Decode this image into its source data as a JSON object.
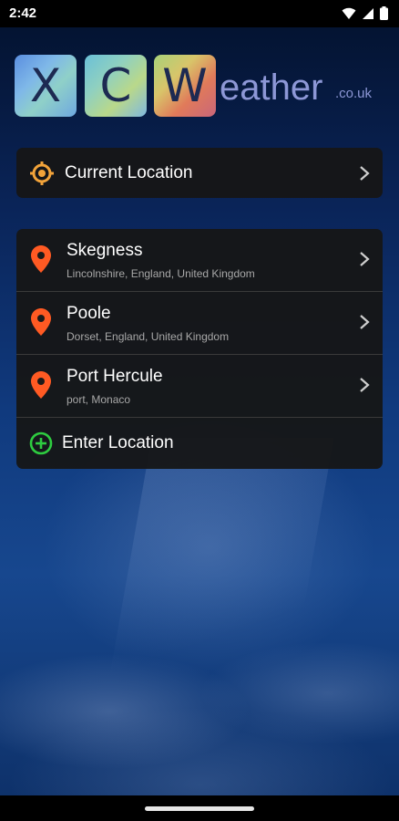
{
  "status_bar": {
    "time": "2:42"
  },
  "logo": {
    "tile_x": "X",
    "tile_c": "C",
    "tile_w": "W",
    "word": "eather",
    "suffix": ".co.uk"
  },
  "current_location": {
    "label": "Current Location"
  },
  "saved_locations": [
    {
      "name": "Skegness",
      "detail": "Lincolnshire, England, United Kingdom"
    },
    {
      "name": "Poole",
      "detail": "Dorset, England, United Kingdom"
    },
    {
      "name": "Port Hercule",
      "detail": "port, Monaco"
    }
  ],
  "enter_location": {
    "label": "Enter Location"
  },
  "colors": {
    "pin": "#ff5a23",
    "target": "#f2a33a",
    "add": "#2ecc40",
    "logo_text": "#8d97d6"
  }
}
